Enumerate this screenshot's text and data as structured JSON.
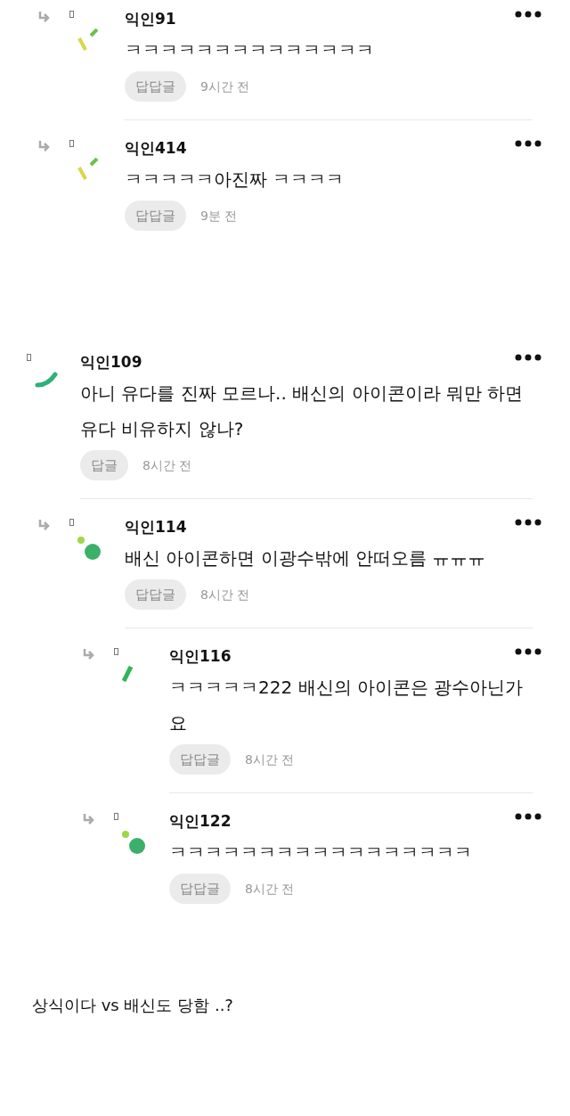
{
  "threads": [
    {
      "replies": [
        {
          "author": "익인91",
          "text": "ㅋㅋㅋㅋㅋㅋㅋㅋㅋㅋㅋㅋㅋㅋ",
          "reply_label": "답답글",
          "time": "9시간 전",
          "kind": "dashes"
        },
        {
          "author": "익인414",
          "text": "ㅋㅋㅋㅋㅋ아진짜 ㅋㅋㅋㅋ",
          "reply_label": "답답글",
          "time": "9분 전",
          "kind": "dashes"
        }
      ]
    },
    {
      "comments": [
        {
          "author": "익인109",
          "text": "아니 유다를 진짜 모르나.. 배신의 아이콘이라 뭐만 하면 유다 비유하지 않나?",
          "reply_label": "답글",
          "time": "8시간 전",
          "kind": "arc",
          "children": [
            {
              "author": "익인114",
              "text": "배신 아이콘하면 이광수밖에 안떠오름 ㅠㅠㅠ",
              "reply_label": "답답글",
              "time": "8시간 전",
              "kind": "dots",
              "children": [
                {
                  "author": "익인116",
                  "text": "ㅋㅋㅋㅋㅋ222 배신의 아이콘은 광수아닌가요",
                  "reply_label": "답답글",
                  "time": "8시간 전",
                  "kind": "bar"
                },
                {
                  "author": "익인122",
                  "text": "ㅋㅋㅋㅋㅋㅋㅋㅋㅋㅋㅋㅋㅋㅋㅋㅋㅋ",
                  "reply_label": "답답글",
                  "time": "8시간 전",
                  "kind": "dots"
                }
              ]
            }
          ]
        }
      ]
    }
  ],
  "caption": "상식이다 vs 배신도 당함 ..?"
}
